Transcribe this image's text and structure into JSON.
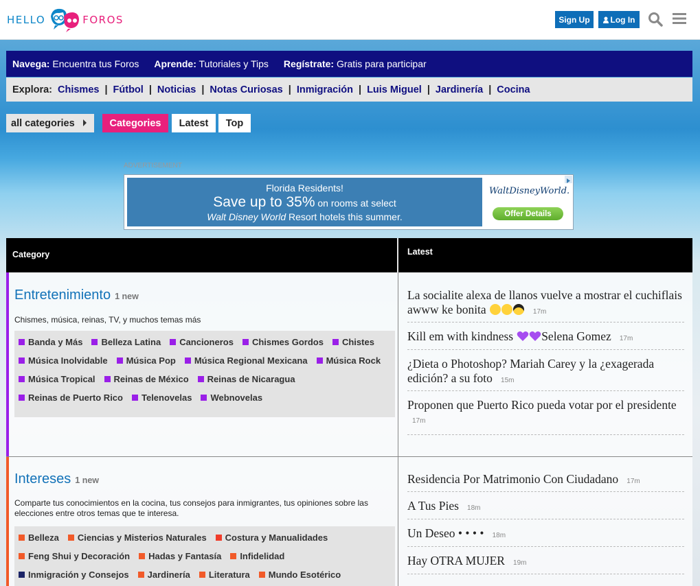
{
  "header": {
    "logo_left": "HELLO",
    "logo_right": "FOROS",
    "signup_label": "Sign Up",
    "login_label": "Log In",
    "search_icon": "search-icon",
    "menu_icon": "hamburger-menu-icon",
    "brand_blue": "#0d86c8",
    "brand_pink": "#e8207c"
  },
  "nav_primary": [
    {
      "label": "Navega:",
      "text": "Encuentra tus Foros"
    },
    {
      "label": "Aprende:",
      "text": "Tutoriales y Tips"
    },
    {
      "label": "Regístrate:",
      "text": "Gratis para participar"
    }
  ],
  "nav_explore": {
    "label": "Explora:",
    "links": [
      "Chismes",
      "Fútbol",
      "Noticias",
      "Notas Curiosas",
      "Inmigración",
      "Luis Miguel",
      "Jardinería",
      "Cocina"
    ]
  },
  "filters": {
    "all_categories": "all categories",
    "tabs": [
      "Categories",
      "Latest",
      "Top"
    ],
    "active_tab": "Categories"
  },
  "ad": {
    "label": "ADVERTISEMENT",
    "line1": "Florida Residents!",
    "line2_big": "Save up to 35%",
    "line2_small": "on rooms at select",
    "line3_italic": "Walt Disney World",
    "line3_rest": "Resort hotels this summer.",
    "brand": "WaltDisneyWorld.",
    "offer_button": "Offer Details"
  },
  "table": {
    "col_category": "Category",
    "col_latest": "Latest",
    "categories": [
      {
        "title": "Entretenimiento",
        "new_badge": "1 new",
        "accent": "#9a1fe8",
        "description": "Chismes, música, reinas, TV, y muchos temas más",
        "sub_lines": [
          [
            {
              "name": "Banda y Más",
              "color": "#9a1fe8"
            },
            {
              "name": "Belleza Latina",
              "color": "#9a1fe8"
            },
            {
              "name": "Cancioneros",
              "color": "#9a1fe8"
            },
            {
              "name": "Chismes Gordos",
              "color": "#9a1fe8"
            },
            {
              "name": "Chistes",
              "color": "#9a1fe8"
            }
          ],
          [
            {
              "name": "Música Inolvidable",
              "color": "#9a1fe8"
            },
            {
              "name": "Música Pop",
              "color": "#9a1fe8"
            },
            {
              "name": "Música Regional Mexicana",
              "color": "#9a1fe8"
            },
            {
              "name": "Música Rock",
              "color": "#9a1fe8"
            }
          ],
          [
            {
              "name": "Música Tropical",
              "color": "#9a1fe8"
            },
            {
              "name": "Reinas de México",
              "color": "#9a1fe8"
            },
            {
              "name": "Reinas de Nicaragua",
              "color": "#9a1fe8"
            }
          ],
          [
            {
              "name": "Reinas de Puerto Rico",
              "color": "#9a1fe8"
            },
            {
              "name": "Telenovelas",
              "color": "#9a1fe8"
            },
            {
              "name": "Webnovelas",
              "color": "#9a1fe8"
            }
          ]
        ],
        "topics": [
          {
            "title": "La socialite alexa de llanos vuelve a mostrar el cuchiflais awww ke bonita",
            "emoji": [
              "scream-emoji",
              "scream-emoji",
              "sunglasses-emoji"
            ],
            "age": "17m"
          },
          {
            "title": "Kill em with kindness",
            "emoji_mid": [
              "purple-heart-emoji",
              "purple-heart-emoji"
            ],
            "title_after": "Selena Gomez",
            "age": "17m"
          },
          {
            "title": "¿Dieta o Photoshop? Mariah Carey y la ¿exagerada edición? a su foto",
            "age": "15m"
          },
          {
            "title": "Proponen que Puerto Rico pueda votar por el presidente",
            "age": "17m"
          }
        ]
      },
      {
        "title": "Intereses",
        "new_badge": "1 new",
        "accent": "#f15a29",
        "description": "Comparte tus conocimientos en la cocina, tus consejos para inmigrantes, tus opiniones sobre las elecciones entre otros temas que te interesa.",
        "sub_lines": [
          [
            {
              "name": "Belleza",
              "color": "#f15a29"
            },
            {
              "name": "Ciencias y Misterios Naturales",
              "color": "#f15a29"
            },
            {
              "name": "Costura y Manualidades",
              "color": "#f03c2a"
            }
          ],
          [
            {
              "name": "Feng Shui y Decoración",
              "color": "#f15a29"
            },
            {
              "name": "Hadas y Fantasía",
              "color": "#f15a29"
            },
            {
              "name": "Infidelidad",
              "color": "#f15a29"
            }
          ],
          [
            {
              "name": "Inmigración y Consejos",
              "color": "#1b2467"
            },
            {
              "name": "Jardinería",
              "color": "#f15a29"
            },
            {
              "name": "Literatura",
              "color": "#f15a29"
            },
            {
              "name": "Mundo Esotérico",
              "color": "#f15a29"
            }
          ]
        ],
        "topics": [
          {
            "title": "Residencia Por Matrimonio Con Ciudadano",
            "age": "17m"
          },
          {
            "title": "A Tus Pies",
            "age": "18m"
          },
          {
            "title": "Un Deseo • • • •",
            "age": "18m"
          },
          {
            "title": "Hay OTRA MUJER",
            "age": "19m"
          }
        ]
      }
    ]
  }
}
